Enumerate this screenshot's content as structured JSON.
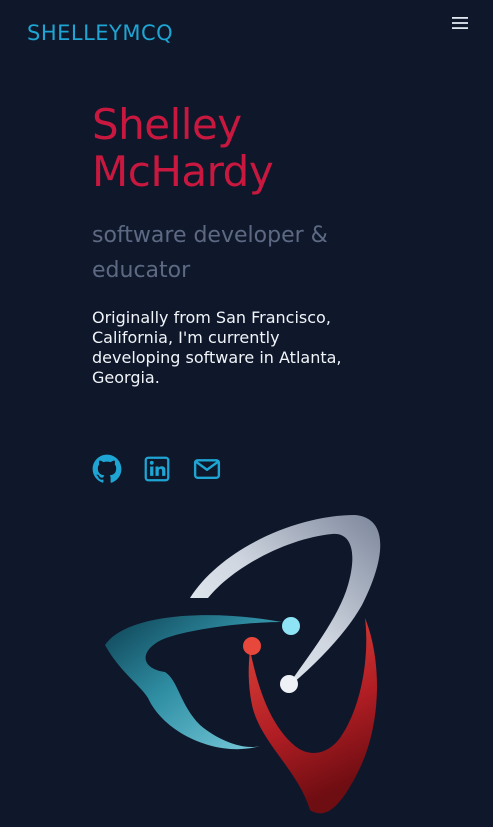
{
  "header": {
    "logo_text": "SHELLEYMCQ",
    "menu_icon": "hamburger-menu-icon"
  },
  "hero": {
    "name_line1": "Shelley",
    "name_line2": "McHardy",
    "tagline_line1": "software developer &",
    "tagline_line2": "educator",
    "bio_lines": [
      "Originally from San Francisco,",
      "California, I'm currently",
      "developing software in Atlanta,",
      "Georgia."
    ]
  },
  "social": {
    "icons": [
      "github-icon",
      "linkedin-icon",
      "email-icon"
    ]
  },
  "colors": {
    "background": "#0f172a",
    "accent": "#c8183f",
    "link": "#1ea5d3",
    "tagline": "#5d6983",
    "body_text": "#f1f5f9"
  }
}
